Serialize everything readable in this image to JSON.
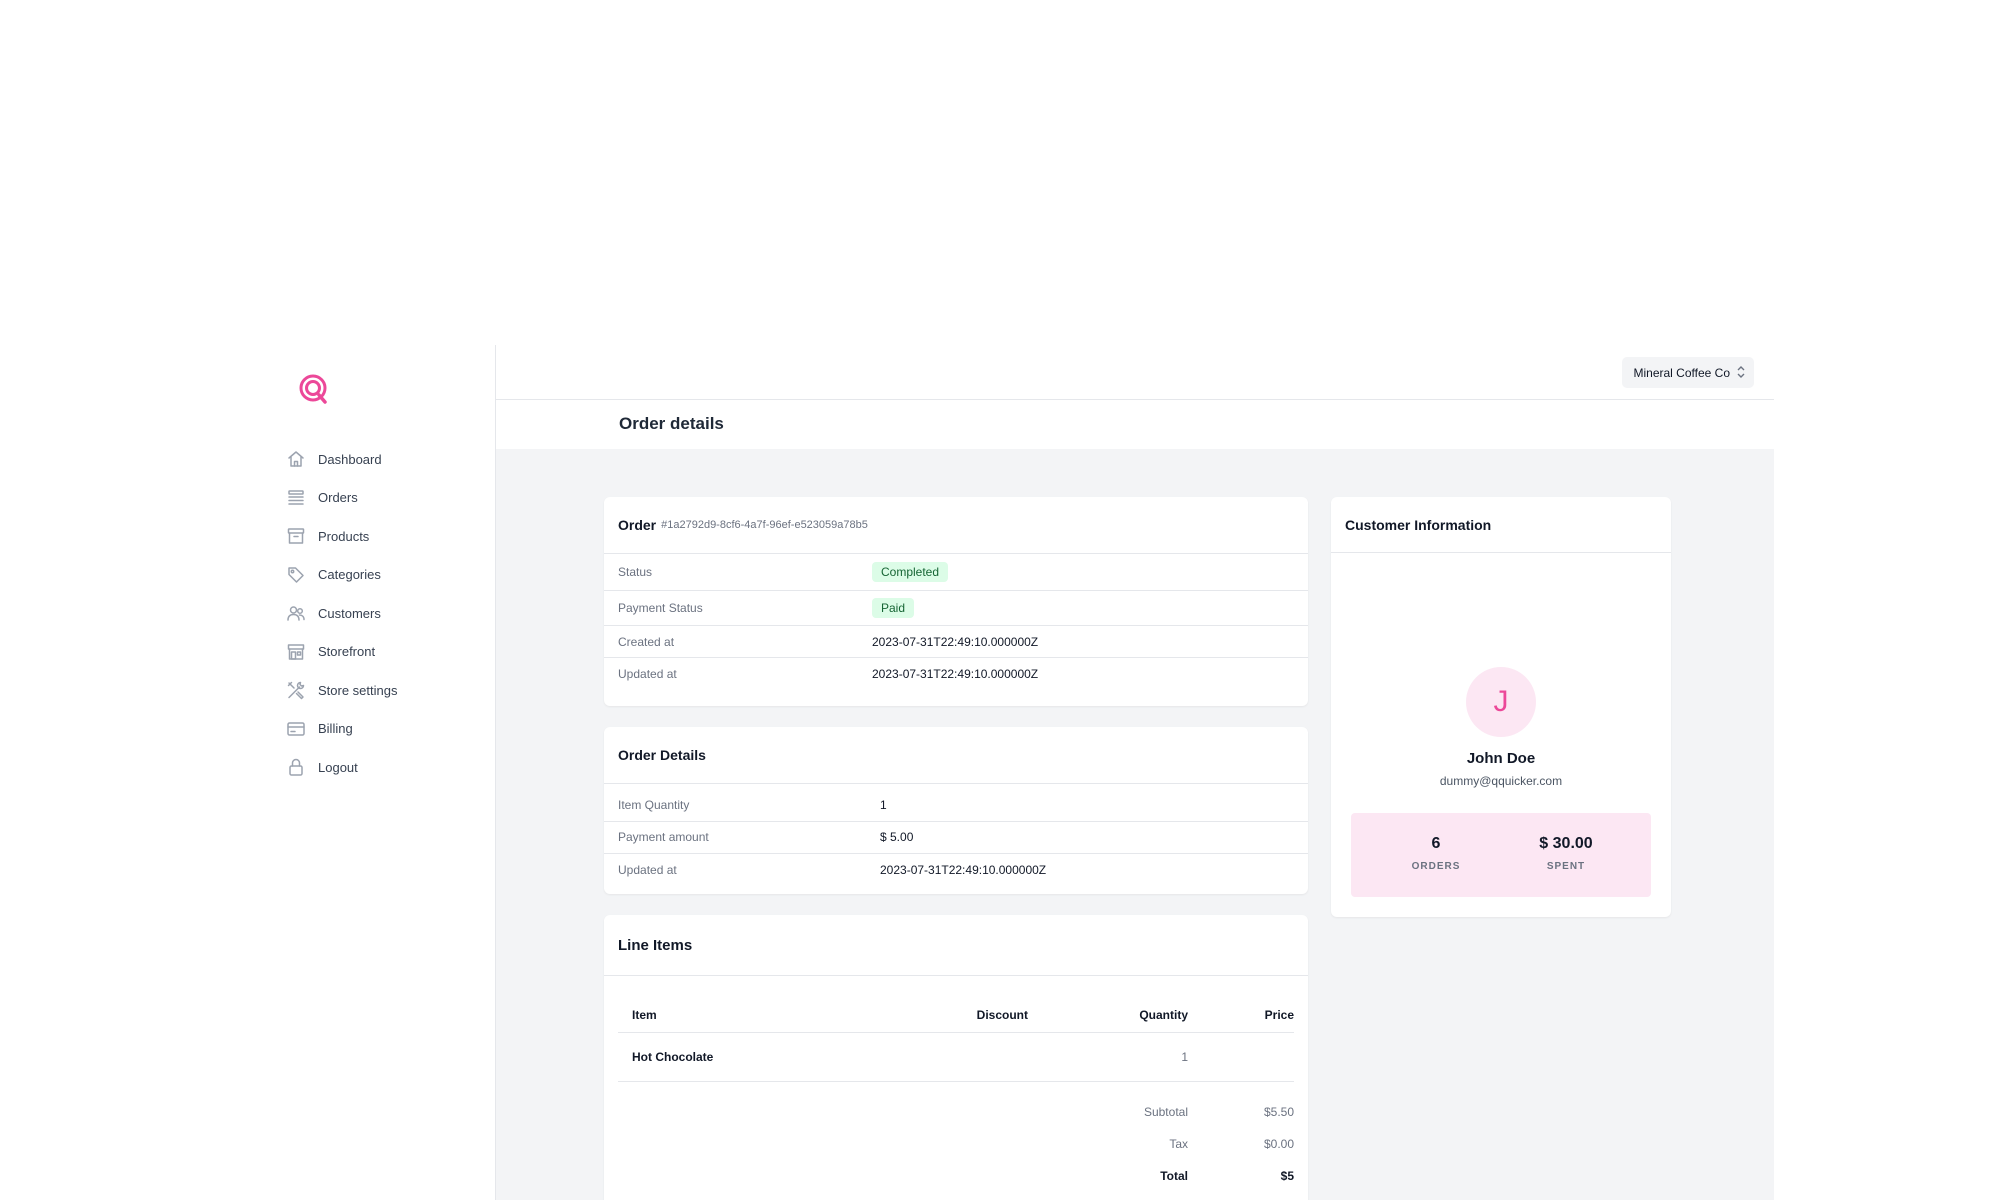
{
  "sidebar": {
    "items": [
      {
        "label": "Dashboard",
        "icon": "home-icon"
      },
      {
        "label": "Orders",
        "icon": "list-icon"
      },
      {
        "label": "Products",
        "icon": "archive-box-icon"
      },
      {
        "label": "Categories",
        "icon": "tag-icon"
      },
      {
        "label": "Customers",
        "icon": "users-icon"
      },
      {
        "label": "Storefront",
        "icon": "storefront-icon"
      },
      {
        "label": "Store settings",
        "icon": "tools-icon"
      },
      {
        "label": "Billing",
        "icon": "credit-card-icon"
      },
      {
        "label": "Logout",
        "icon": "lock-icon"
      }
    ]
  },
  "header": {
    "store_name": "Mineral Coffee Co",
    "page_title": "Order details"
  },
  "order": {
    "title": "Order",
    "id": "#1a2792d9-8cf6-4a7f-96ef-e523059a78b5",
    "rows": [
      {
        "label": "Status",
        "value": "Completed"
      },
      {
        "label": "Payment Status",
        "value": "Paid"
      },
      {
        "label": "Created at",
        "value": "2023-07-31T22:49:10.000000Z"
      },
      {
        "label": "Updated at",
        "value": "2023-07-31T22:49:10.000000Z"
      }
    ]
  },
  "order_details": {
    "title": "Order Details",
    "rows": [
      {
        "label": "Item Quantity",
        "value": "1"
      },
      {
        "label": "Payment amount",
        "value": "$ 5.00"
      },
      {
        "label": "Updated at",
        "value": "2023-07-31T22:49:10.000000Z"
      }
    ]
  },
  "line_items": {
    "title": "Line Items",
    "columns": [
      "Item",
      "Discount",
      "Quantity",
      "Price"
    ],
    "rows": [
      {
        "item": "Hot Chocolate",
        "discount": "",
        "quantity": "1",
        "price": ""
      }
    ],
    "subtotal_label": "Subtotal",
    "subtotal": "$5.50",
    "tax_label": "Tax",
    "tax": "$0.00",
    "total_label": "Total",
    "total": "$5"
  },
  "customer": {
    "title": "Customer Information",
    "initial": "J",
    "name": "John Doe",
    "email": "dummy@qquicker.com",
    "orders_value": "6",
    "orders_label": "ORDERS",
    "spent_value": "$ 30.00",
    "spent_label": "SPENT"
  },
  "colors": {
    "accent": "#ec4899",
    "accent_light": "#fce7f3",
    "badge_bg": "#dcfce7",
    "badge_text": "#166534"
  }
}
